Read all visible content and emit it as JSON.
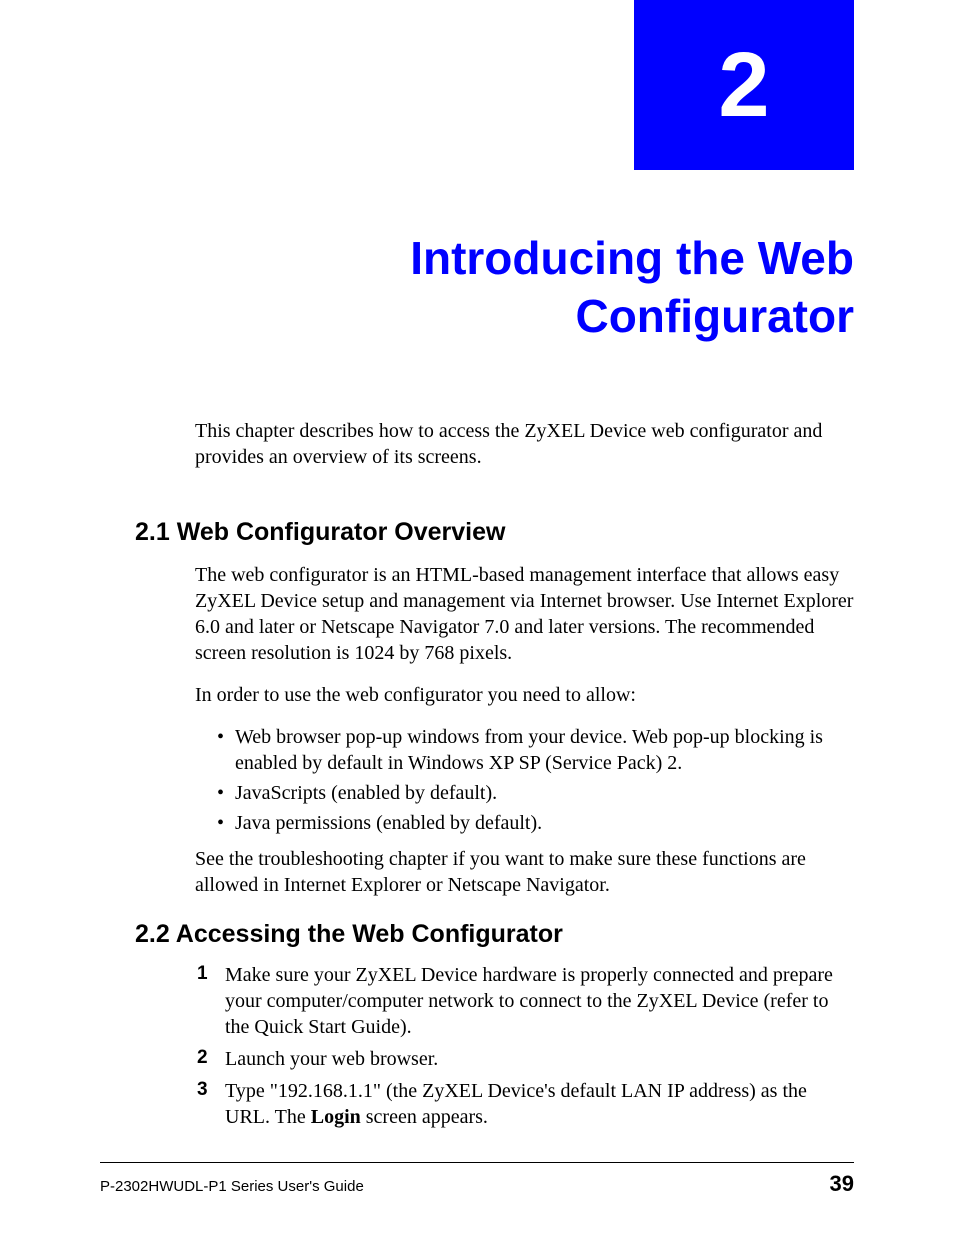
{
  "chapter": {
    "number": "2",
    "title": "Introducing the Web Configurator"
  },
  "intro": "This chapter describes how to access the ZyXEL Device web configurator and provides an overview of its screens.",
  "section1": {
    "heading": "2.1  Web Configurator Overview",
    "para1": "The web configurator is an HTML-based management interface that allows easy ZyXEL Device setup and management via Internet browser. Use Internet Explorer 6.0 and later or Netscape Navigator 7.0 and later versions. The recommended screen resolution is 1024 by 768 pixels.",
    "para2": "In order to use the web configurator you need to allow:",
    "bullets": [
      "Web browser pop-up windows from your device. Web pop-up blocking is enabled by default in Windows XP SP (Service Pack) 2.",
      "JavaScripts (enabled by default).",
      "Java permissions (enabled by default)."
    ],
    "para3": "See the troubleshooting chapter if you want to make sure these functions are allowed in Internet Explorer or Netscape Navigator."
  },
  "section2": {
    "heading": "2.2  Accessing the Web Configurator",
    "steps": [
      {
        "num": "1",
        "text": "Make sure your ZyXEL Device hardware is properly connected and prepare your computer/computer network to connect to the ZyXEL Device (refer to the Quick Start Guide)."
      },
      {
        "num": "2",
        "text": "Launch your web browser."
      },
      {
        "num": "3",
        "text_prefix": "Type \"192.168.1.1\" (the ZyXEL Device's default LAN IP address) as the URL. The ",
        "bold": "Login",
        "text_suffix": " screen appears."
      }
    ]
  },
  "footer": {
    "guide": "P-2302HWUDL-P1 Series User's Guide",
    "page": "39"
  }
}
